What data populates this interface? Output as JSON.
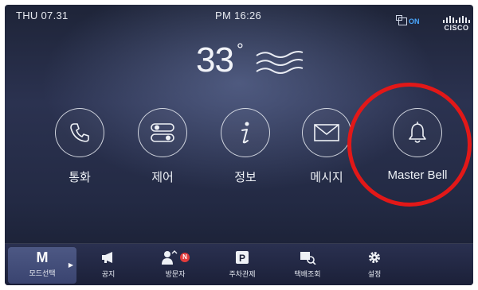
{
  "status": {
    "date": "THU 07.31",
    "time": "PM 16:26",
    "connection": "ON",
    "brand": "CISCO"
  },
  "weather": {
    "temperature": "33",
    "degree_symbol": "°",
    "condition_icon": "wind-icon"
  },
  "menu": [
    {
      "label": "통화",
      "icon": "phone-icon"
    },
    {
      "label": "제어",
      "icon": "toggle-icon"
    },
    {
      "label": "정보",
      "icon": "info-icon"
    },
    {
      "label": "메시지",
      "icon": "envelope-icon"
    },
    {
      "label": "Master Bell",
      "icon": "bell-icon"
    }
  ],
  "highlight": {
    "target": "Master Bell",
    "color": "#e21818"
  },
  "bottom_bar": {
    "mode": {
      "letter": "M",
      "label": "모드선택"
    },
    "badge": "N",
    "items": [
      {
        "label": "공지",
        "icon": "megaphone-icon"
      },
      {
        "label": "방문자",
        "icon": "visitor-icon"
      },
      {
        "label": "주차관제",
        "icon": "parking-icon"
      },
      {
        "label": "택배조회",
        "icon": "delivery-icon"
      },
      {
        "label": "설정",
        "icon": "gear-icon"
      }
    ]
  },
  "colors": {
    "background": "#232a44",
    "accent_on": "#4aa8ff",
    "badge": "#e23b3b"
  }
}
